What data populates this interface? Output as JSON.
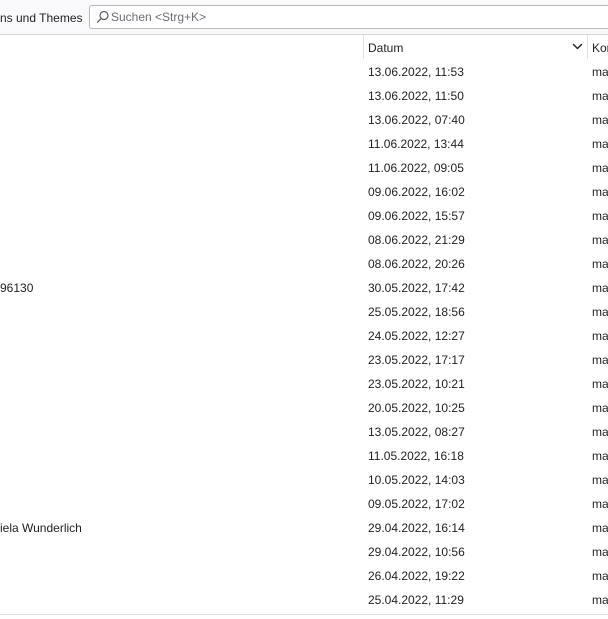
{
  "toolbar": {
    "addons_label": "ns und Themes",
    "search_placeholder": "Suchen <Strg+K>"
  },
  "columns": {
    "date_header": "Datum",
    "correspondent_header": "Kor"
  },
  "rows": [
    {
      "subject": "",
      "date": "13.06.2022, 11:53",
      "correspondent": "ma"
    },
    {
      "subject": "",
      "date": "13.06.2022, 11:50",
      "correspondent": "ma"
    },
    {
      "subject": "",
      "date": "13.06.2022, 07:40",
      "correspondent": "ma"
    },
    {
      "subject": "",
      "date": "11.06.2022, 13:44",
      "correspondent": "ma"
    },
    {
      "subject": "",
      "date": "11.06.2022, 09:05",
      "correspondent": "ma"
    },
    {
      "subject": "",
      "date": "09.06.2022, 16:02",
      "correspondent": "ma"
    },
    {
      "subject": "",
      "date": "09.06.2022, 15:57",
      "correspondent": "ma"
    },
    {
      "subject": "",
      "date": "08.06.2022, 21:29",
      "correspondent": "ma"
    },
    {
      "subject": "",
      "date": "08.06.2022, 20:26",
      "correspondent": "ma"
    },
    {
      "subject": "96130",
      "date": "30.05.2022, 17:42",
      "correspondent": "ma"
    },
    {
      "subject": "",
      "date": "25.05.2022, 18:56",
      "correspondent": "ma"
    },
    {
      "subject": "",
      "date": "24.05.2022, 12:27",
      "correspondent": "ma"
    },
    {
      "subject": "",
      "date": "23.05.2022, 17:17",
      "correspondent": "ma"
    },
    {
      "subject": "",
      "date": "23.05.2022, 10:21",
      "correspondent": "ma"
    },
    {
      "subject": "",
      "date": "20.05.2022, 10:25",
      "correspondent": "ma"
    },
    {
      "subject": "",
      "date": "13.05.2022, 08:27",
      "correspondent": "ma"
    },
    {
      "subject": "",
      "date": "11.05.2022, 16:18",
      "correspondent": "ma"
    },
    {
      "subject": "",
      "date": "10.05.2022, 14:03",
      "correspondent": "ma"
    },
    {
      "subject": "",
      "date": "09.05.2022, 17:02",
      "correspondent": "ma"
    },
    {
      "subject": "iela Wunderlich",
      "date": "29.04.2022, 16:14",
      "correspondent": "ma"
    },
    {
      "subject": "",
      "date": "29.04.2022, 10:56",
      "correspondent": "ma"
    },
    {
      "subject": "",
      "date": "26.04.2022, 19:22",
      "correspondent": "ma"
    },
    {
      "subject": "",
      "date": "25.04.2022, 11:29",
      "correspondent": "ma"
    }
  ],
  "icons": {
    "search": "search-icon",
    "sort": "chevron-down-icon"
  }
}
